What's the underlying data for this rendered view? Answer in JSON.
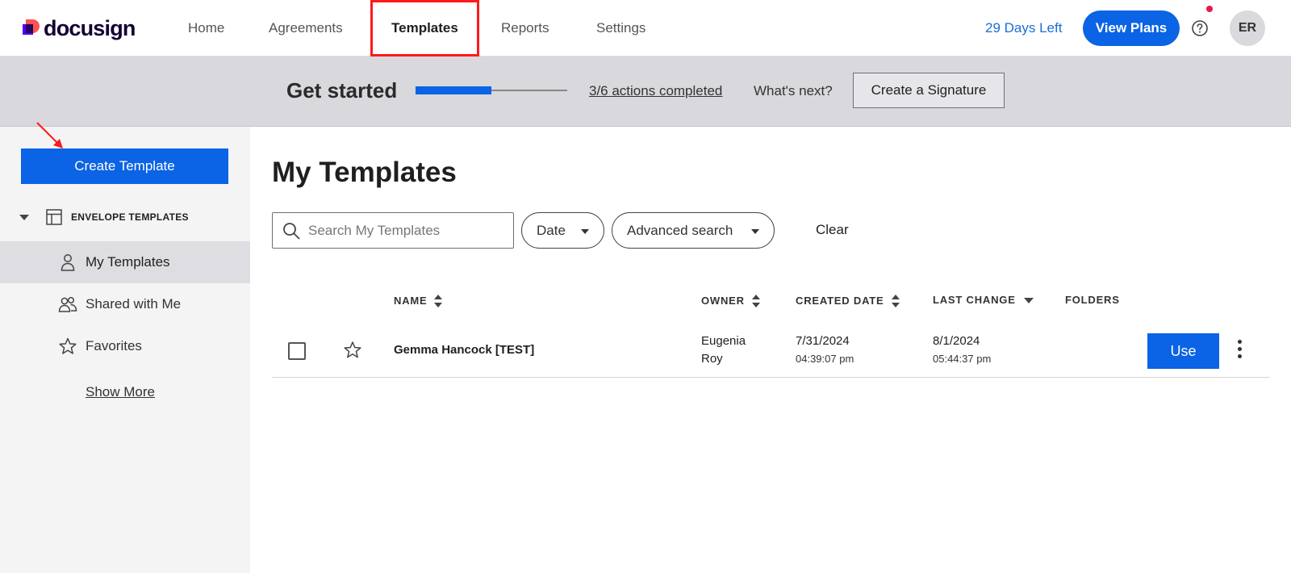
{
  "brand": {
    "name": "docusign",
    "colors": {
      "primary": "#0b63e5",
      "highlight": "#ff1a1a",
      "logo_purple": "#4c00ff",
      "logo_coral": "#ff5252",
      "notification": "#e5194b"
    }
  },
  "nav": {
    "items": [
      {
        "label": "Home",
        "active": false
      },
      {
        "label": "Agreements",
        "active": false
      },
      {
        "label": "Templates",
        "active": true
      },
      {
        "label": "Reports",
        "active": false
      },
      {
        "label": "Settings",
        "active": false
      }
    ],
    "trial_text": "29 Days Left",
    "view_plans_label": "View Plans",
    "help_icon": "help-circle-icon",
    "avatar_initials": "ER"
  },
  "banner": {
    "title": "Get started",
    "progress_fraction": 0.5,
    "actions_text": "3/6 actions completed",
    "whats_next": "What's next?",
    "cta_label": "Create a Signature"
  },
  "sidebar": {
    "create_label": "Create Template",
    "section_label": "ENVELOPE TEMPLATES",
    "items": [
      {
        "label": "My Templates",
        "icon": "person-icon",
        "active": true
      },
      {
        "label": "Shared with Me",
        "icon": "people-icon",
        "active": false
      },
      {
        "label": "Favorites",
        "icon": "star-icon",
        "active": false
      }
    ],
    "show_more": "Show More"
  },
  "main": {
    "title": "My Templates",
    "search_placeholder": "Search My Templates",
    "date_filter": "Date",
    "advanced_search": "Advanced search",
    "clear_label": "Clear",
    "columns": {
      "name": "NAME",
      "owner": "OWNER",
      "created": "CREATED DATE",
      "last_change": "LAST CHANGE",
      "folders": "FOLDERS"
    },
    "rows": [
      {
        "name": "Gemma Hancock [TEST]",
        "owner_first": "Eugenia",
        "owner_last": "Roy",
        "created_date": "7/31/2024",
        "created_time": "04:39:07 pm",
        "changed_date": "8/1/2024",
        "changed_time": "05:44:37 pm",
        "action_label": "Use"
      }
    ]
  }
}
